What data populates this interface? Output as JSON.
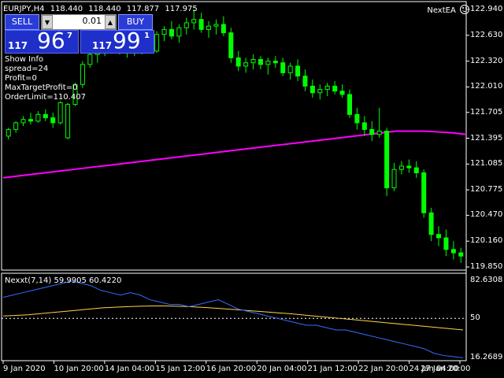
{
  "header": {
    "symbol": "EURJPY,H4",
    "open": "118.440",
    "high": "118.440",
    "low": "117.877",
    "close": "117.975",
    "ea_name": "NextEA",
    "ea_icon": "smiley-icon"
  },
  "trade_panel": {
    "sell_label": "SELL",
    "buy_label": "BUY",
    "lot": "0.01",
    "sell_quote": {
      "small": "117",
      "big": "96",
      "sup": "7"
    },
    "buy_quote": {
      "small": "117",
      "big": "99",
      "sup": "1"
    }
  },
  "info": {
    "title": "Show Info",
    "spread": "spread=24",
    "profit": "Profit=0",
    "max_target_profit": "MaxTargetProfit=0",
    "order_limit": "OrderLimit=110.407"
  },
  "price_axis": [
    "122.940",
    "122.630",
    "122.320",
    "122.010",
    "121.705",
    "121.395",
    "121.085",
    "120.775",
    "120.470",
    "120.160",
    "119.850"
  ],
  "indicator": {
    "label": "Nexxt(7,14) 59.9905 60.4220",
    "axis": [
      "82.6308",
      "50",
      "16.2689"
    ],
    "level": 50
  },
  "time_axis": [
    "9 Jan 2020",
    "10 Jan 20:00",
    "14 Jan 04:00",
    "15 Jan 12:00",
    "16 Jan 20:00",
    "20 Jan 04:00",
    "21 Jan 12:00",
    "22 Jan 20:00",
    "24 Jan 04:00",
    "27 Jan 20:00"
  ],
  "colors": {
    "background": "#000000",
    "candle": "#00ff00",
    "ma": "#ff00ff",
    "fast_line": "#3a6bff",
    "slow_line": "#ffd24a",
    "panel_button": "#2b3cd6"
  },
  "chart_data": {
    "type": "candlestick",
    "price_range": [
      119.85,
      122.94
    ],
    "candles": [
      [
        121.42,
        121.52,
        121.38,
        121.5
      ],
      [
        121.5,
        121.6,
        121.46,
        121.58
      ],
      [
        121.58,
        121.66,
        121.54,
        121.62
      ],
      [
        121.62,
        121.7,
        121.56,
        121.6
      ],
      [
        121.6,
        121.72,
        121.58,
        121.68
      ],
      [
        121.68,
        121.74,
        121.6,
        121.64
      ],
      [
        121.64,
        121.7,
        121.52,
        121.58
      ],
      [
        121.58,
        121.84,
        121.56,
        121.82
      ],
      [
        121.4,
        121.82,
        121.38,
        121.8
      ],
      [
        121.8,
        122.06,
        121.78,
        122.04
      ],
      [
        122.04,
        122.32,
        122.0,
        122.28
      ],
      [
        122.28,
        122.44,
        122.24,
        122.4
      ],
      [
        122.4,
        122.52,
        122.3,
        122.46
      ],
      [
        122.46,
        122.58,
        122.38,
        122.54
      ],
      [
        122.54,
        122.66,
        122.46,
        122.6
      ],
      [
        122.6,
        122.66,
        122.4,
        122.48
      ],
      [
        122.48,
        122.58,
        122.36,
        122.52
      ],
      [
        122.52,
        122.6,
        122.38,
        122.46
      ],
      [
        122.46,
        122.56,
        122.4,
        122.5
      ],
      [
        122.5,
        122.6,
        122.42,
        122.44
      ],
      [
        122.44,
        122.68,
        122.42,
        122.64
      ],
      [
        122.64,
        122.74,
        122.56,
        122.7
      ],
      [
        122.7,
        122.8,
        122.58,
        122.62
      ],
      [
        122.62,
        122.76,
        122.54,
        122.72
      ],
      [
        122.72,
        122.84,
        122.64,
        122.78
      ],
      [
        122.78,
        122.94,
        122.7,
        122.82
      ],
      [
        122.82,
        122.9,
        122.66,
        122.7
      ],
      [
        122.7,
        122.8,
        122.6,
        122.74
      ],
      [
        122.74,
        122.82,
        122.64,
        122.76
      ],
      [
        122.76,
        122.86,
        122.62,
        122.66
      ],
      [
        122.66,
        122.72,
        122.3,
        122.36
      ],
      [
        122.36,
        122.44,
        122.2,
        122.26
      ],
      [
        122.26,
        122.36,
        122.18,
        122.3
      ],
      [
        122.3,
        122.4,
        122.22,
        122.34
      ],
      [
        122.34,
        122.38,
        122.22,
        122.28
      ],
      [
        122.28,
        122.36,
        122.16,
        122.32
      ],
      [
        122.32,
        122.38,
        122.24,
        122.3
      ],
      [
        122.3,
        122.36,
        122.14,
        122.18
      ],
      [
        122.18,
        122.3,
        122.1,
        122.26
      ],
      [
        122.26,
        122.34,
        122.08,
        122.14
      ],
      [
        122.14,
        122.22,
        121.96,
        122.02
      ],
      [
        122.02,
        122.1,
        121.88,
        121.94
      ],
      [
        121.94,
        122.04,
        121.86,
        121.98
      ],
      [
        121.98,
        122.06,
        121.9,
        122.02
      ],
      [
        122.02,
        122.08,
        121.92,
        121.96
      ],
      [
        121.96,
        122.04,
        121.88,
        121.92
      ],
      [
        121.92,
        121.98,
        121.64,
        121.68
      ],
      [
        121.68,
        121.76,
        121.5,
        121.58
      ],
      [
        121.58,
        121.66,
        121.42,
        121.5
      ],
      [
        121.5,
        121.6,
        121.36,
        121.44
      ],
      [
        121.44,
        121.76,
        121.4,
        121.48
      ],
      [
        121.48,
        121.52,
        120.7,
        120.8
      ],
      [
        120.8,
        121.1,
        120.76,
        121.02
      ],
      [
        121.02,
        121.12,
        120.96,
        121.06
      ],
      [
        121.06,
        121.14,
        120.98,
        121.04
      ],
      [
        121.04,
        121.12,
        120.92,
        120.98
      ],
      [
        120.98,
        121.02,
        120.44,
        120.5
      ],
      [
        120.5,
        120.56,
        120.16,
        120.24
      ],
      [
        120.24,
        120.34,
        120.1,
        120.2
      ],
      [
        120.2,
        120.3,
        119.98,
        120.06
      ],
      [
        120.06,
        120.16,
        119.94,
        120.02
      ],
      [
        120.02,
        120.08,
        119.9,
        119.98
      ]
    ],
    "ma": [
      120.92,
      120.94,
      120.96,
      120.98,
      121.0,
      121.02,
      121.04,
      121.06,
      121.08,
      121.1,
      121.12,
      121.14,
      121.16,
      121.18,
      121.2,
      121.22,
      121.24,
      121.26,
      121.28,
      121.3,
      121.32,
      121.34,
      121.36,
      121.38,
      121.4,
      121.42,
      121.44,
      121.46,
      121.48,
      121.48,
      121.48,
      121.47,
      121.46,
      121.44
    ],
    "indicator_fast": [
      68,
      70,
      72,
      74,
      76,
      78,
      80,
      82,
      80,
      78,
      74,
      72,
      70,
      72,
      70,
      66,
      64,
      62,
      62,
      60,
      62,
      64,
      66,
      62,
      58,
      56,
      54,
      52,
      50,
      48,
      46,
      44,
      44,
      42,
      40,
      40,
      38,
      36,
      34,
      32,
      30,
      28,
      26,
      24,
      20,
      18,
      17,
      16
    ],
    "indicator_slow": [
      52,
      52.5,
      53,
      54,
      55,
      56,
      57,
      58,
      59,
      59.5,
      60,
      60.4,
      60.6,
      60.6,
      60.4,
      60,
      59.4,
      58.8,
      58,
      57.2,
      56.4,
      55.6,
      54.8,
      54,
      53,
      52,
      51,
      50,
      49,
      48,
      47,
      46,
      45,
      44,
      43,
      42,
      41,
      40
    ]
  }
}
